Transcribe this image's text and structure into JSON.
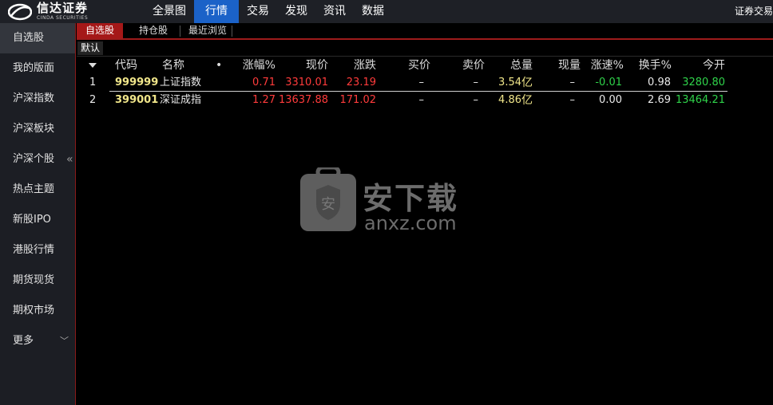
{
  "brand": {
    "name_cn": "信达证券",
    "name_en": "CINDA SECURITIES"
  },
  "nav": [
    "全景图",
    "行情",
    "交易",
    "发现",
    "资讯",
    "数据"
  ],
  "nav_active": "行情",
  "top_right": "证券交易",
  "sidebar": {
    "items": [
      "自选股",
      "我的版面",
      "沪深指数",
      "沪深板块",
      "沪深个股",
      "热点主题",
      "新股IPO",
      "港股行情",
      "期货现货",
      "期权市场",
      "更多"
    ],
    "active": "自选股",
    "collapse_glyph": "«",
    "more_glyph": "﹀"
  },
  "tabs": [
    "自选股",
    "持仓股",
    "最近浏览"
  ],
  "subtab": "默认",
  "table": {
    "headers": [
      "代码",
      "名称",
      "•",
      "涨幅%",
      "现价",
      "涨跌",
      "买价",
      "卖价",
      "总量",
      "现量",
      "涨速%",
      "换手%",
      "今开"
    ],
    "rows": [
      {
        "idx": "1",
        "code": "999999",
        "name": "上证指数",
        "pct": "0.71",
        "price": "3310.01",
        "chg": "23.19",
        "bid": "–",
        "ask": "–",
        "vol": "3.54",
        "vol_unit": "亿",
        "cur": "–",
        "speed": "-0.01",
        "turn": "0.98",
        "open": "3280.80"
      },
      {
        "idx": "2",
        "code": "399001",
        "name": "深证成指",
        "pct": "1.27",
        "price": "13637.88",
        "chg": "171.02",
        "bid": "–",
        "ask": "–",
        "vol": "4.86",
        "vol_unit": "亿",
        "cur": "–",
        "speed": "0.00",
        "turn": "2.69",
        "open": "13464.21"
      }
    ]
  },
  "watermark": {
    "text": "安下载",
    "sub": "anxz.com",
    "shield_char": "安"
  },
  "colors": {
    "accent": "#1b62c8",
    "tab_red": "#a51818",
    "up": "#ff3b3b",
    "down": "#2fd34a",
    "code": "#f1e68a"
  }
}
